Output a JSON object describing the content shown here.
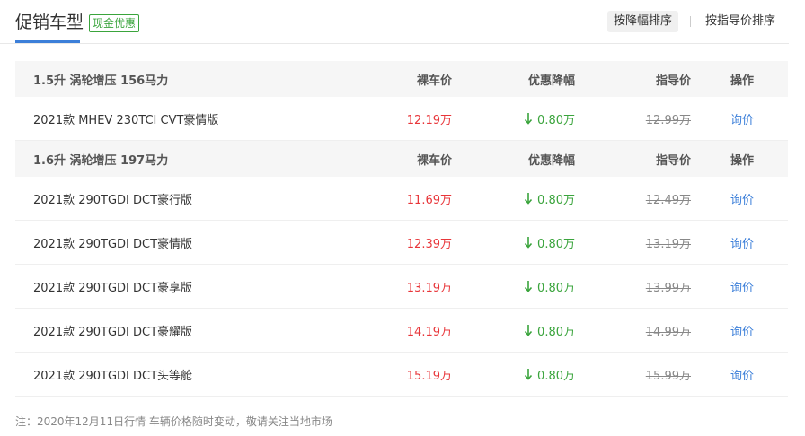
{
  "header": {
    "title": "促销车型",
    "badge": "现金优惠",
    "sort_active": "按降幅排序",
    "sort_normal": "按指导价排序"
  },
  "columns": {
    "price": "裸车价",
    "discount": "优惠降幅",
    "guide": "指导价",
    "op": "操作"
  },
  "groups": [
    {
      "engine": "1.5升 涡轮增压 156马力",
      "items": [
        {
          "name": "2021款 MHEV 230TCI CVT豪情版",
          "price": "12.19万",
          "discount": "0.80万",
          "guide": "12.99万",
          "op": "询价"
        }
      ]
    },
    {
      "engine": "1.6升 涡轮增压 197马力",
      "items": [
        {
          "name": "2021款 290TGDI DCT豪行版",
          "price": "11.69万",
          "discount": "0.80万",
          "guide": "12.49万",
          "op": "询价"
        },
        {
          "name": "2021款 290TGDI DCT豪情版",
          "price": "12.39万",
          "discount": "0.80万",
          "guide": "13.19万",
          "op": "询价"
        },
        {
          "name": "2021款 290TGDI DCT豪享版",
          "price": "13.19万",
          "discount": "0.80万",
          "guide": "13.99万",
          "op": "询价"
        },
        {
          "name": "2021款 290TGDI DCT豪耀版",
          "price": "14.19万",
          "discount": "0.80万",
          "guide": "14.99万",
          "op": "询价"
        },
        {
          "name": "2021款 290TGDI DCT头等舱",
          "price": "15.19万",
          "discount": "0.80万",
          "guide": "15.99万",
          "op": "询价"
        }
      ]
    }
  ],
  "note": "注：2020年12月11日行情 车辆价格随时变动，敬请关注当地市场",
  "colors": {
    "accent": "#3c7fd9",
    "price": "#e8363a",
    "discount": "#3aa43c"
  },
  "icons": {
    "discount": "arrow-down-icon"
  }
}
